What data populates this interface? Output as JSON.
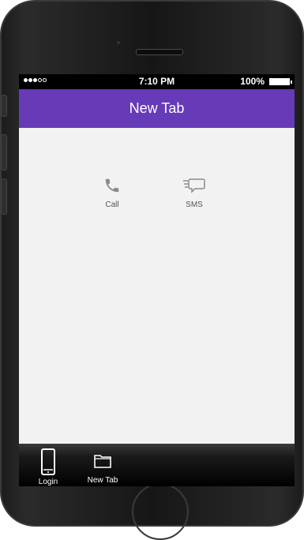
{
  "status_bar": {
    "time": "7:10 PM",
    "battery": "100%"
  },
  "header": {
    "title": "New Tab"
  },
  "actions": [
    {
      "label": "Call",
      "icon": "phone-icon"
    },
    {
      "label": "SMS",
      "icon": "sms-icon"
    }
  ],
  "tabs": [
    {
      "label": "Login",
      "icon": "mobile-icon"
    },
    {
      "label": "New Tab",
      "icon": "folder-icon"
    }
  ],
  "colors": {
    "header": "#673ab7",
    "screen_bg": "#f2f2f3",
    "icon": "#8a8a8a"
  }
}
